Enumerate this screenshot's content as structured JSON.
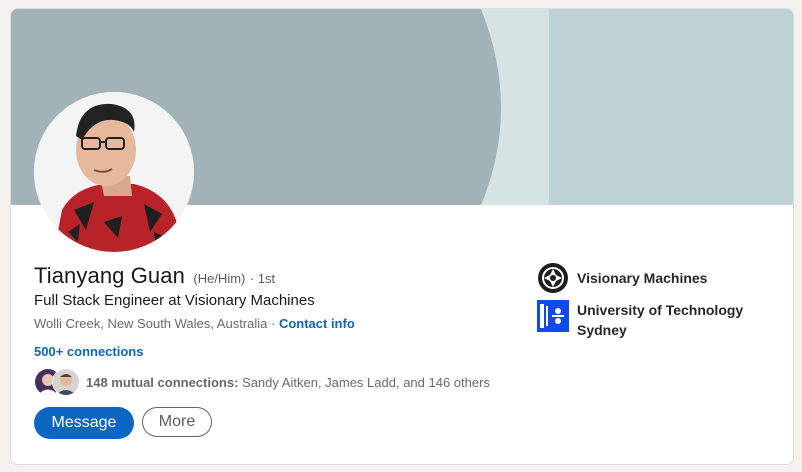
{
  "profile": {
    "name": "Tianyang Guan",
    "pronouns": "(He/Him)",
    "degree": "· 1st",
    "headline": "Full Stack Engineer at Visionary Machines",
    "location": "Wolli Creek, New South Wales, Australia",
    "location_separator": " · ",
    "contact_info_label": "Contact info",
    "connections_label": "500+ connections"
  },
  "mutual": {
    "label": "148 mutual connections:",
    "names": " Sandy Aitken, James Ladd, and 146 others"
  },
  "actions": {
    "message_label": "Message",
    "more_label": "More"
  },
  "organizations": [
    {
      "name": "Visionary Machines",
      "icon": "visionary-machines-logo"
    },
    {
      "name": "University of Technology Sydney",
      "icon": "uts-logo"
    }
  ],
  "colors": {
    "link": "#0a66c2",
    "primary_button": "#0a66c2",
    "banner_light": "#bfd3d6",
    "banner_dark": "#a1b3b6",
    "uts_blue": "#0f4beb"
  }
}
